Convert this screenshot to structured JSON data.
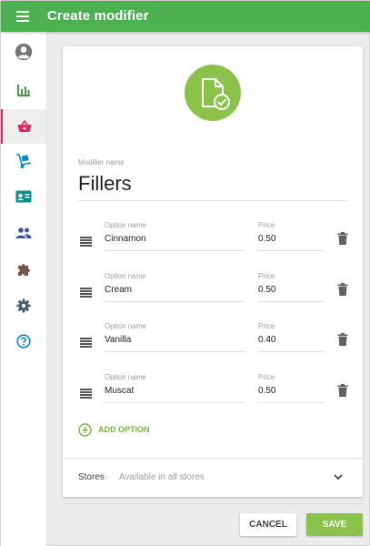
{
  "colors": {
    "primary": "#4caf50",
    "accent": "#8bc34a",
    "active_nav_indicator": "#e91e63"
  },
  "header": {
    "title": "Create modifier",
    "menu_icon": "hamburger-menu-icon"
  },
  "sidebar": {
    "items": [
      {
        "name": "account",
        "icon": "account-circle-icon",
        "active": false
      },
      {
        "name": "reports",
        "icon": "bar-chart-icon",
        "active": false
      },
      {
        "name": "items",
        "icon": "basket-icon",
        "active": true
      },
      {
        "name": "inventory",
        "icon": "dolly-icon",
        "active": false
      },
      {
        "name": "employees",
        "icon": "id-card-icon",
        "active": false
      },
      {
        "name": "customers",
        "icon": "people-icon",
        "active": false
      },
      {
        "name": "integrations",
        "icon": "puzzle-icon",
        "active": false
      },
      {
        "name": "settings",
        "icon": "gear-icon",
        "active": false
      },
      {
        "name": "help",
        "icon": "help-icon",
        "active": false
      }
    ]
  },
  "form": {
    "header_icon": "document-check-icon",
    "modifier_name_label": "Modifier name",
    "modifier_name": "Fillers",
    "option_name_label": "Option name",
    "price_label": "Price",
    "options": [
      {
        "name": "Cinnamon",
        "price": "0.50"
      },
      {
        "name": "Cream",
        "price": "0.50"
      },
      {
        "name": "Vanilla",
        "price": "0.40"
      },
      {
        "name": "Muscat",
        "price": "0.50"
      }
    ],
    "add_option_label": "ADD OPTION",
    "stores_label": "Stores",
    "stores_value": "Available in all stores"
  },
  "actions": {
    "cancel_label": "CANCEL",
    "save_label": "SAVE"
  }
}
